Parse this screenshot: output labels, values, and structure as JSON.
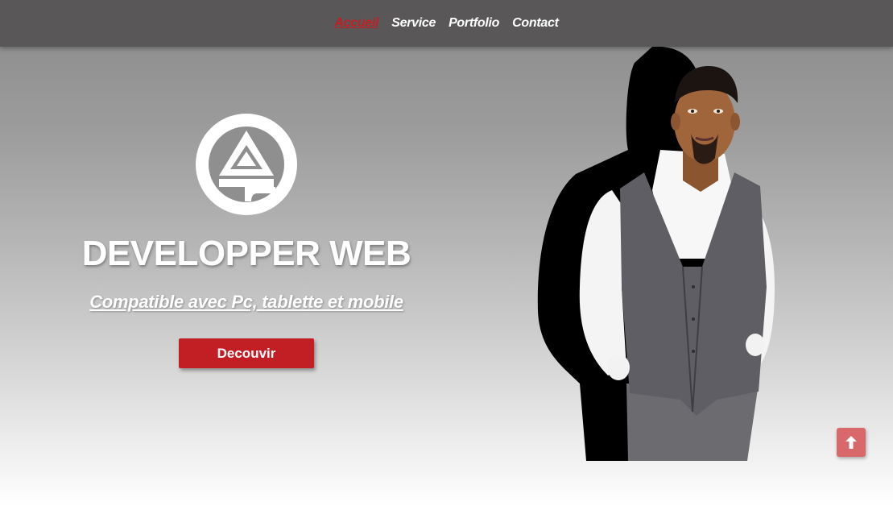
{
  "nav": {
    "items": [
      {
        "label": "Accueil",
        "active": true
      },
      {
        "label": "Service",
        "active": false
      },
      {
        "label": "Portfolio",
        "active": false
      },
      {
        "label": "Contact",
        "active": false
      }
    ]
  },
  "hero": {
    "title": "DEVELOPPER WEB",
    "subtitle": "Compatible avec Pc, tablette et mobile",
    "button_label": "Decouvir"
  },
  "icons": {
    "logo": "brand-logo",
    "illustration": "developer-illustration",
    "scroll_top": "arrow-up-icon"
  },
  "colors": {
    "accent": "#c21f25",
    "navbar": "#595758",
    "scroll_top_button": "#d9686b"
  }
}
